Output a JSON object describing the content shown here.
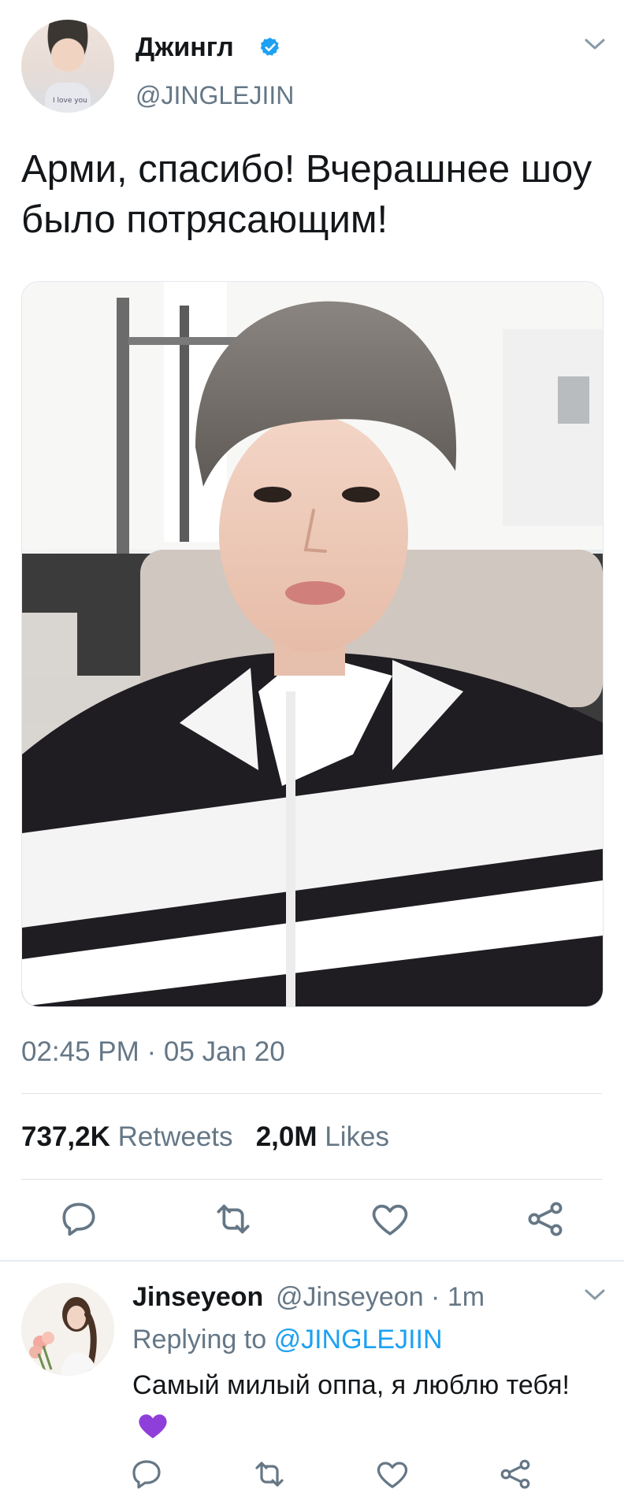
{
  "tweet": {
    "display_name": "Джингл",
    "handle": "@JINGLEJIIN",
    "text": "Арми, спасибо! Вчерашнее шоу было потрясающим!",
    "timestamp": "02:45 PM · 05 Jan 20",
    "retweets_count": "737,2K",
    "retweets_label": "Retweets",
    "likes_count": "2,0M",
    "likes_label": "Likes",
    "avatar_caption": "I love you",
    "icons": [
      "verified-badge-icon",
      "chevron-down-icon",
      "reply-icon",
      "retweet-icon",
      "like-icon",
      "share-icon"
    ]
  },
  "reply": {
    "display_name": "Jinseyeon",
    "meta": "@Jinseyeon · 1m",
    "replying_prefix": "Replying to",
    "replying_handle": "@JINGLEJIIN",
    "text": "Самый милый оппа, я люблю тебя!",
    "emoji": "purple-heart",
    "icons": [
      "chevron-down-icon",
      "reply-icon",
      "retweet-icon",
      "like-icon",
      "share-icon"
    ]
  },
  "colors": {
    "accent": "#1da1f2",
    "muted": "#657786",
    "emoji_heart": "#8e3fd9"
  }
}
